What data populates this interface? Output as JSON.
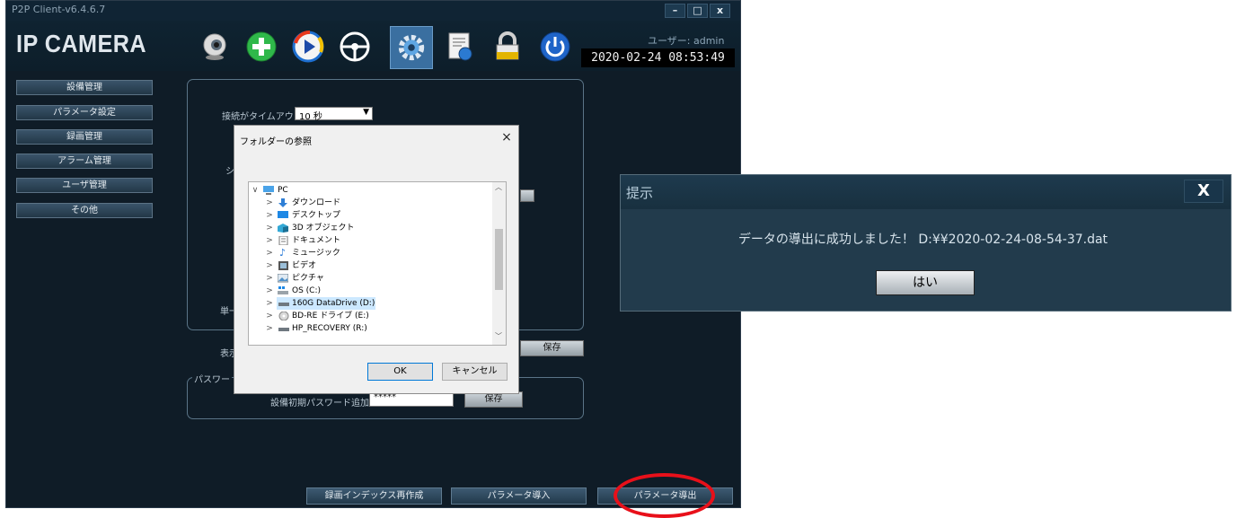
{
  "app": {
    "window_title": "P2P Client-v6.4.6.7",
    "logo": "IP CAMERA",
    "user_label": "ユーザー: admin",
    "clock": "2020-02-24 08:53:49",
    "window_controls": {
      "minimize": "–",
      "maximize": "□",
      "close": "x"
    },
    "toolbar_icons": [
      "webcam-icon",
      "add-icon",
      "play-icon",
      "steering-wheel-icon",
      "settings-gear-icon",
      "document-icon",
      "lock-icon",
      "power-icon"
    ]
  },
  "sidebar": {
    "items": [
      {
        "label": "設備管理"
      },
      {
        "label": "パラメータ設定"
      },
      {
        "label": "録画管理"
      },
      {
        "label": "アラーム管理"
      },
      {
        "label": "ユーザ管理"
      },
      {
        "label": "その他"
      }
    ]
  },
  "settings": {
    "timeout_label": "接続がタイムアウト",
    "timeout_value": "10 秒",
    "partial_label_1": "シ",
    "partial_label_2": "単一",
    "display_label": "表示",
    "save_label": "保存",
    "password_group_label": "パスワー",
    "password_label": "設備初期パスワード追加",
    "password_value": "*****",
    "save_label_2": "保存"
  },
  "bottom_buttons": {
    "rebuild_index": "録画インデックス再作成",
    "import_params": "パラメータ導入",
    "export_params": "パラメータ導出"
  },
  "folder_dialog": {
    "title": "フォルダーの参照",
    "close": "×",
    "tree": [
      {
        "label": "PC",
        "expanded": true
      },
      {
        "label": "ダウンロード"
      },
      {
        "label": "デスクトップ"
      },
      {
        "label": "3D オブジェクト"
      },
      {
        "label": "ドキュメント"
      },
      {
        "label": "ミュージック"
      },
      {
        "label": "ビデオ"
      },
      {
        "label": "ピクチャ"
      },
      {
        "label": "OS (C:)"
      },
      {
        "label": "160G DataDrive (D:)",
        "selected": true
      },
      {
        "label": "BD-RE ドライブ (E:)"
      },
      {
        "label": "HP_RECOVERY (R:)"
      }
    ],
    "ok": "OK",
    "cancel": "キャンセル"
  },
  "notice": {
    "title": "提示",
    "close": "X",
    "message": "データの導出に成功しました！ D:¥¥2020-02-24-08-54-37.dat",
    "yes": "はい"
  },
  "colors": {
    "app_bg": "#0f1c27",
    "highlight_circle": "#e8101a",
    "tree_selection": "#cce8ff"
  }
}
